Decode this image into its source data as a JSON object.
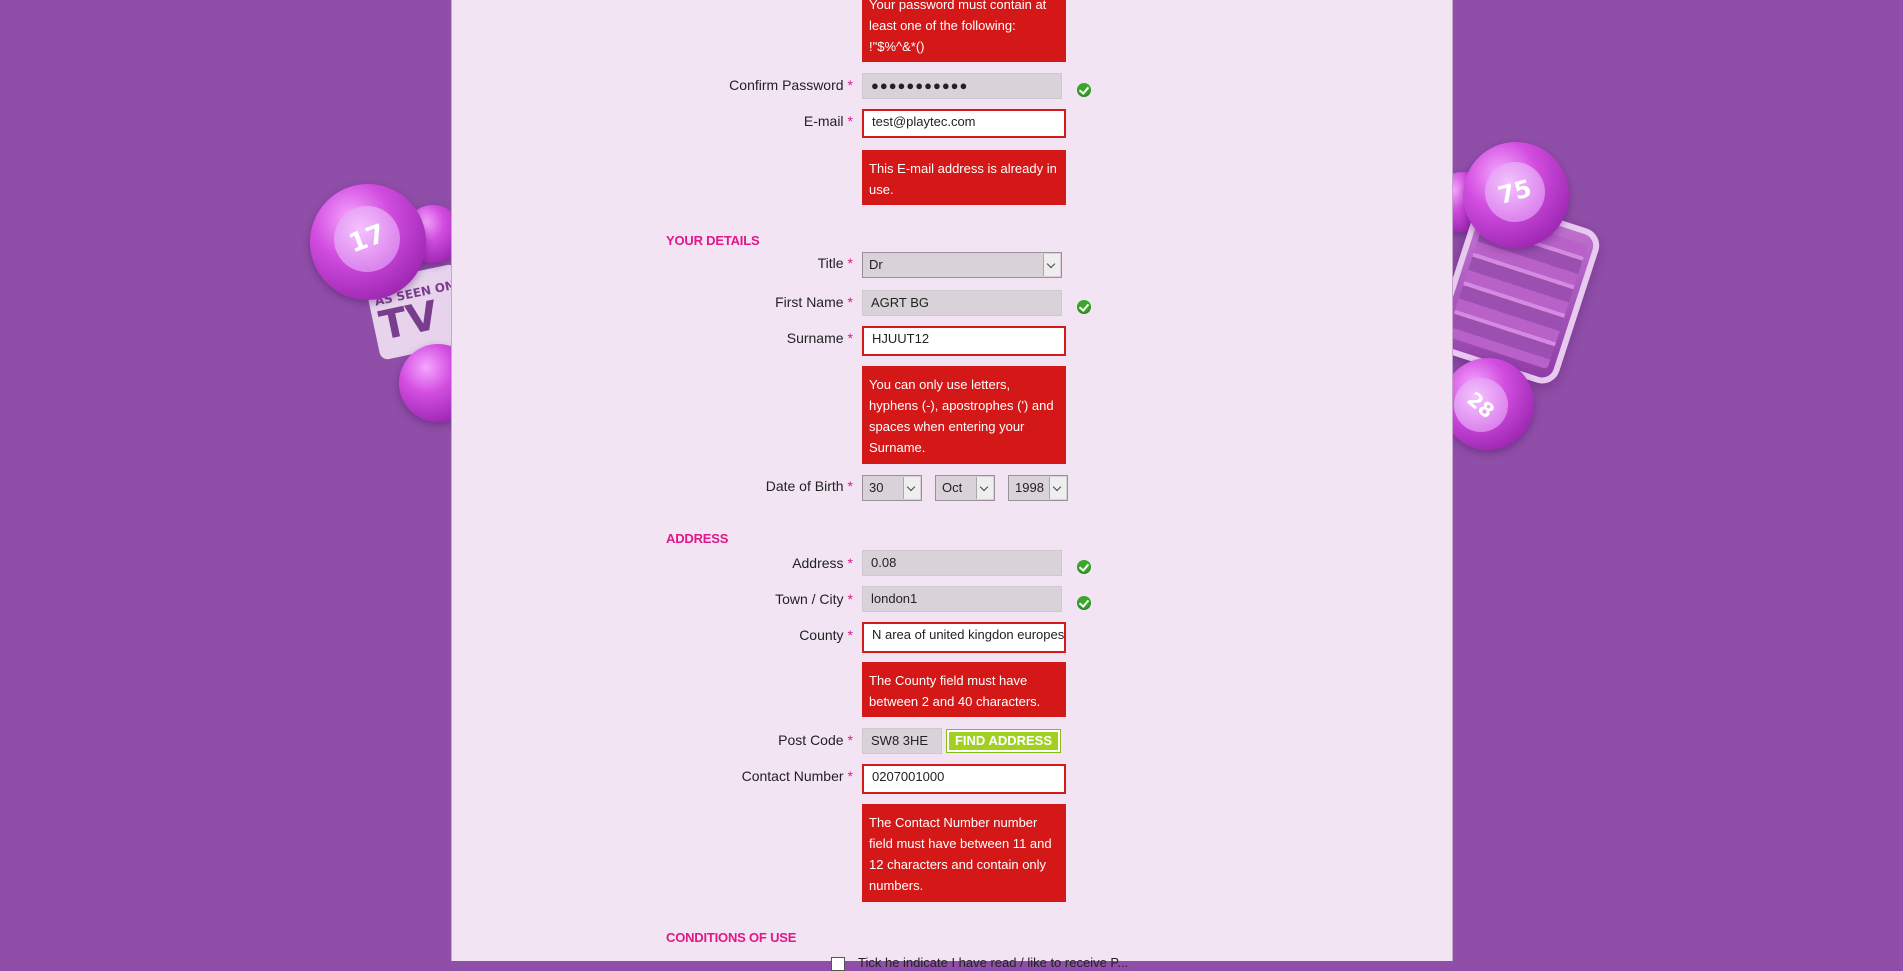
{
  "errors": {
    "password": "Your password must contain at least one of the following: !\"$%^&*()",
    "email": "This E-mail address is already in use.",
    "surname": "You can only use letters, hyphens (-), apostrophes (') and spaces when entering your Surname.",
    "county": "The County field must have between 2 and 40 characters.",
    "contact": "The Contact Number number field must have between 11 and 12 characters and contain only numbers."
  },
  "required_marker": "*",
  "fields": {
    "confirm_password": {
      "label": "Confirm Password",
      "value": "●●●●●●●●●●●"
    },
    "email": {
      "label": "E-mail",
      "value": "test@playtec.com"
    },
    "title": {
      "label": "Title",
      "value": "Dr"
    },
    "first_name": {
      "label": "First Name",
      "value": "AGRT BG"
    },
    "surname": {
      "label": "Surname",
      "value": "HJUUT12"
    },
    "dob": {
      "label": "Date of Birth",
      "day": "30",
      "month": "Oct",
      "year": "1998"
    },
    "address": {
      "label": "Address",
      "value": "0.08"
    },
    "town": {
      "label": "Town / City",
      "value": "london1"
    },
    "county": {
      "label": "County",
      "value": "N area of united kingdon europes"
    },
    "postcode": {
      "label": "Post Code",
      "value": "SW8 3HE"
    },
    "contact": {
      "label": "Contact Number",
      "value": "0207001000"
    }
  },
  "sections": {
    "details": "YOUR DETAILS",
    "address": "ADDRESS",
    "conditions": "CONDITIONS OF USE"
  },
  "buttons": {
    "find_address": "FIND ADDRESS"
  },
  "conditions": {
    "terms_text": "Tick he indicate I have read / like to receive P..."
  },
  "decor": {
    "balls": [
      "17",
      "75",
      "28"
    ],
    "tv_text": "AS SEEN ON",
    "tv_big": "TV"
  },
  "colors": {
    "background": "#8f4ea8",
    "panel": "#f3e4f3",
    "accent": "#e0188a",
    "error": "#d41717",
    "ok": "#3aa72b",
    "button": "#9fd022"
  }
}
